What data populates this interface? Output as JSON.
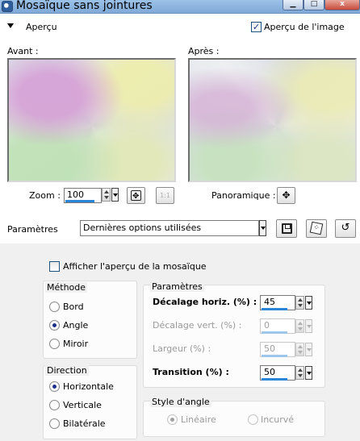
{
  "window": {
    "title": "Mosaïque sans jointures",
    "close_label": "x"
  },
  "preview": {
    "section_label": "Aperçu",
    "show_preview_label": "Aperçu de l'image",
    "show_preview_checked": true,
    "before_label": "Avant :",
    "after_label": "Après :"
  },
  "zoom": {
    "label": "Zoom :",
    "value": "100",
    "fit_button_label": "1:1",
    "pan_label": "Panoramique :"
  },
  "presets": {
    "label": "Paramètres",
    "selected": "Dernières options utilisées"
  },
  "mosaic_preview": {
    "label": "Afficher l'aperçu de la mosaïque",
    "checked": false
  },
  "method": {
    "title": "Méthode",
    "options": [
      "Bord",
      "Angle",
      "Miroir"
    ],
    "selected": "Angle"
  },
  "direction": {
    "title": "Direction",
    "options": [
      "Horizontale",
      "Verticale",
      "Bilatérale"
    ],
    "selected": "Horizontale"
  },
  "parameters": {
    "title": "Paramètres",
    "fields": [
      {
        "label": "Décalage horiz. (%) :",
        "value": "45",
        "enabled": true,
        "bar_percent": 45
      },
      {
        "label": "Décalage vert. (%) :",
        "value": "0",
        "enabled": false,
        "bar_percent": 0
      },
      {
        "label": "Largeur (%) :",
        "value": "50",
        "enabled": false,
        "bar_percent": 50
      },
      {
        "label": "Transition (%) :",
        "value": "50",
        "enabled": true,
        "bar_percent": 50
      }
    ]
  },
  "angle_style": {
    "title": "Style d'angle",
    "options": [
      "Linéaire",
      "Incurvé"
    ],
    "selected": "Linéaire",
    "enabled": false
  }
}
